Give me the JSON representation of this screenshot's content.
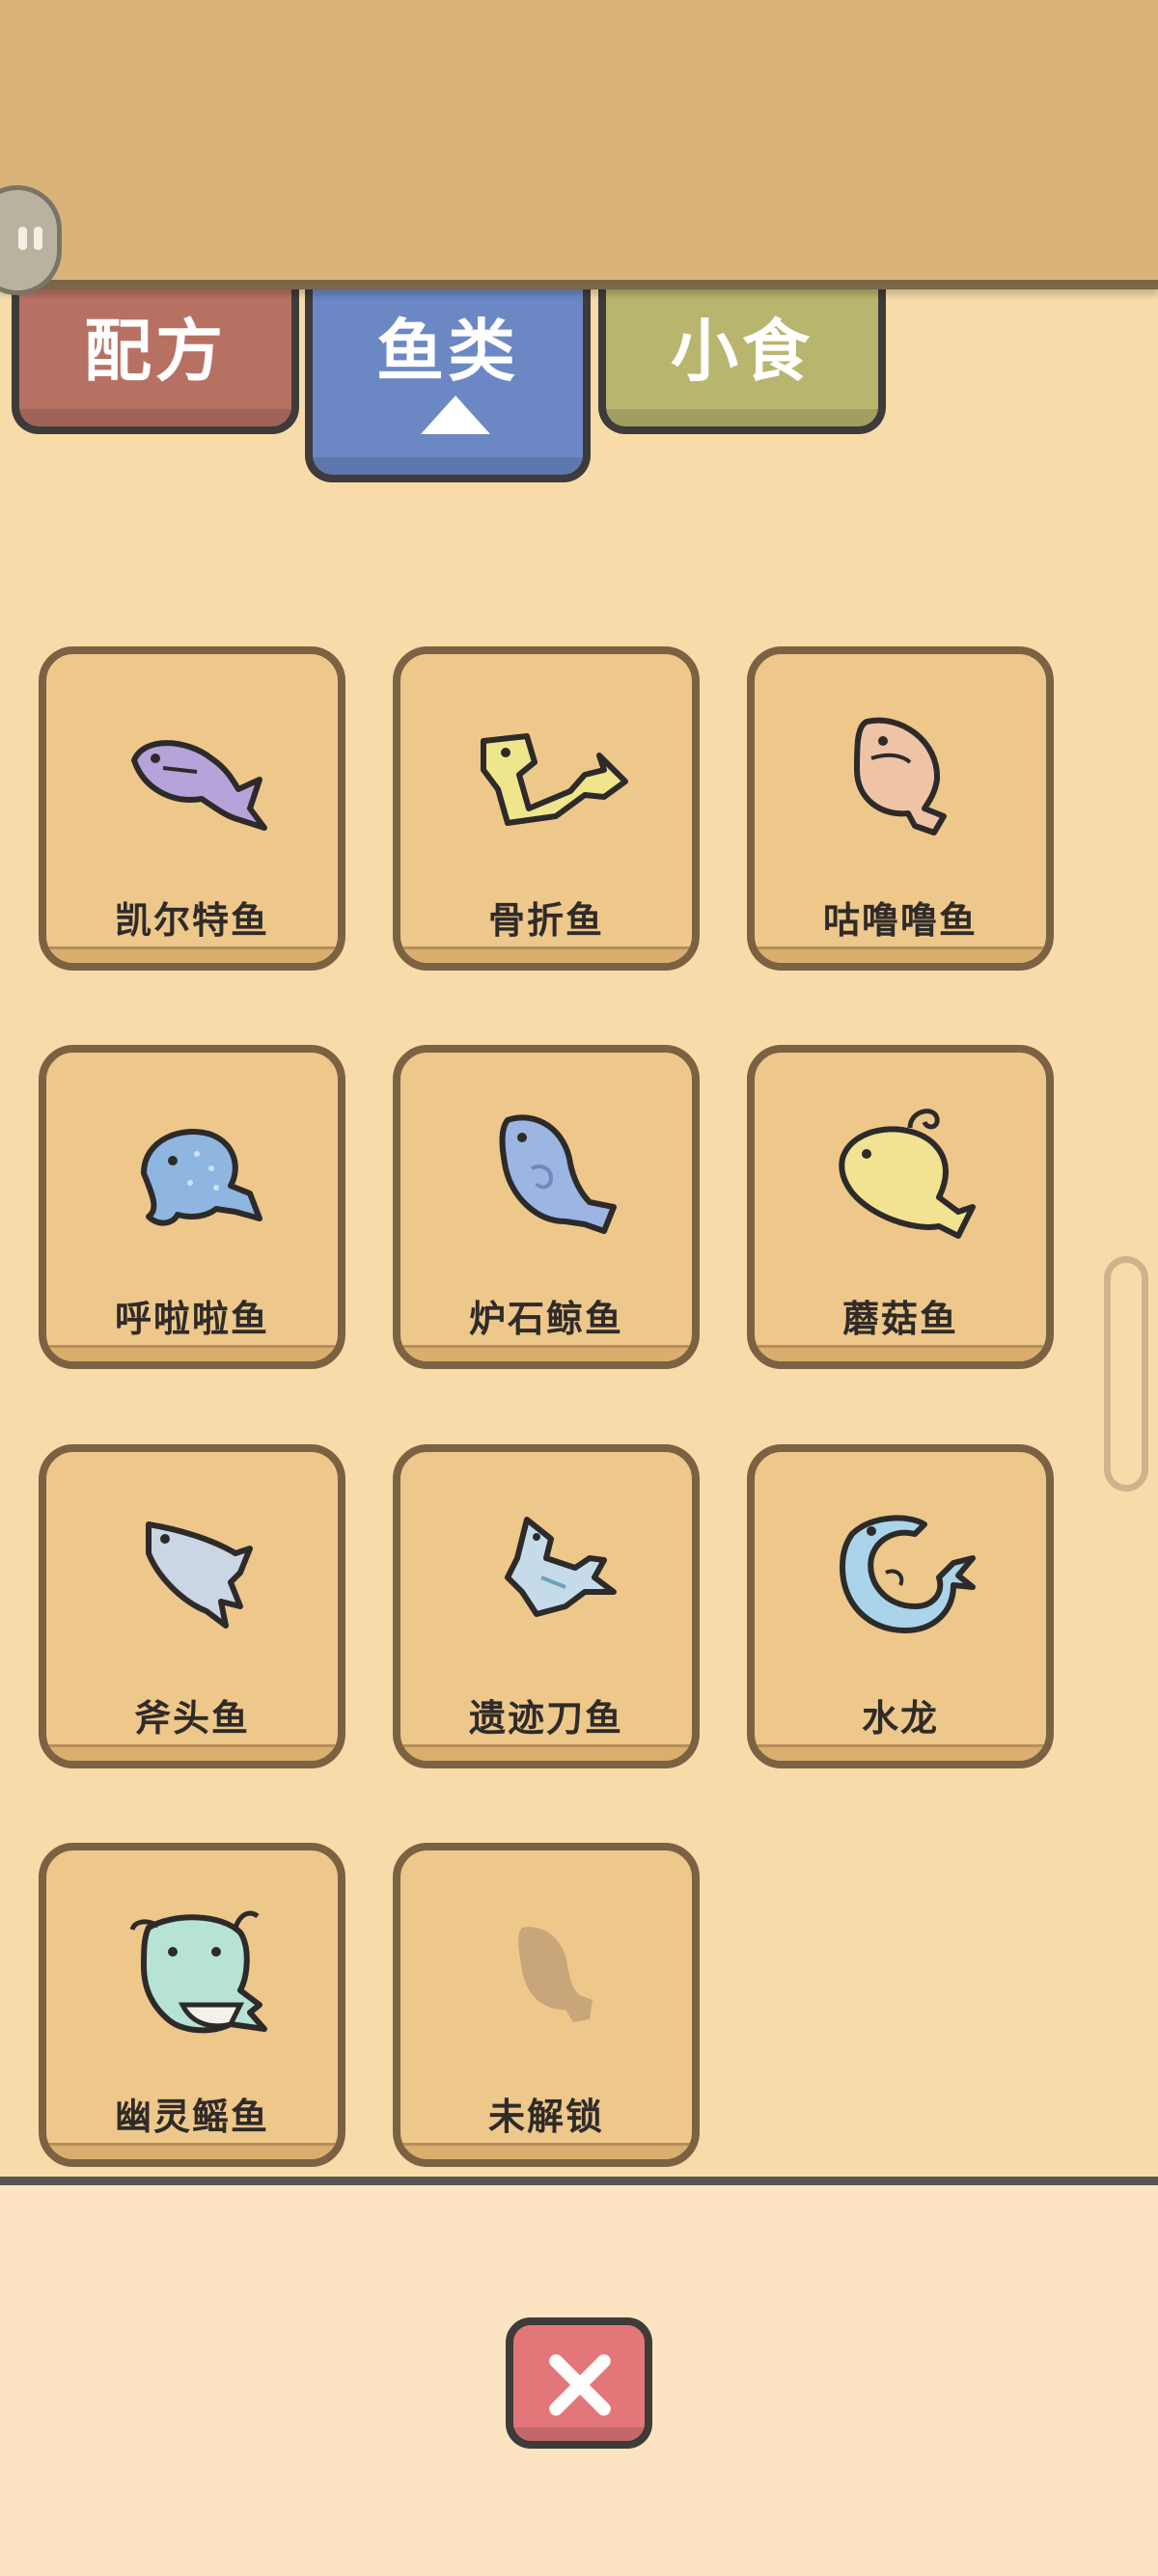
{
  "tabs": [
    {
      "label": "配方",
      "color": "#b67163"
    },
    {
      "label": "鱼类",
      "color": "#6b88c4",
      "selected": true
    },
    {
      "label": "小食",
      "color": "#b8b56e"
    }
  ],
  "fish": [
    {
      "name": "凯尔特鱼",
      "icon": "purple-fish-icon",
      "color": "#b6a3d9"
    },
    {
      "name": "骨折鱼",
      "icon": "yellow-bent-fish-icon",
      "color": "#eee58d"
    },
    {
      "name": "咕噜噜鱼",
      "icon": "pink-round-fish-icon",
      "color": "#eec3a6"
    },
    {
      "name": "呼啦啦鱼",
      "icon": "blue-spotted-fish-icon",
      "color": "#8fb6e0"
    },
    {
      "name": "炉石鲸鱼",
      "icon": "blue-whale-icon",
      "color": "#9cb5e3"
    },
    {
      "name": "蘑菇鱼",
      "icon": "yellow-puffer-fish-icon",
      "color": "#f1e391"
    },
    {
      "name": "斧头鱼",
      "icon": "grey-blue-fish-icon",
      "color": "#cbd5e3"
    },
    {
      "name": "遗迹刀鱼",
      "icon": "blade-fish-icon",
      "color": "#c6dbea"
    },
    {
      "name": "水龙",
      "icon": "water-dragon-icon",
      "color": "#a9d4ea"
    },
    {
      "name": "幽灵鳐鱼",
      "icon": "ghost-ray-icon",
      "color": "#b6e3d6"
    },
    {
      "name": "未解锁",
      "icon": "locked-fish-silhouette-icon",
      "color": "#c9a679"
    }
  ],
  "close_icon": "close-x-icon"
}
